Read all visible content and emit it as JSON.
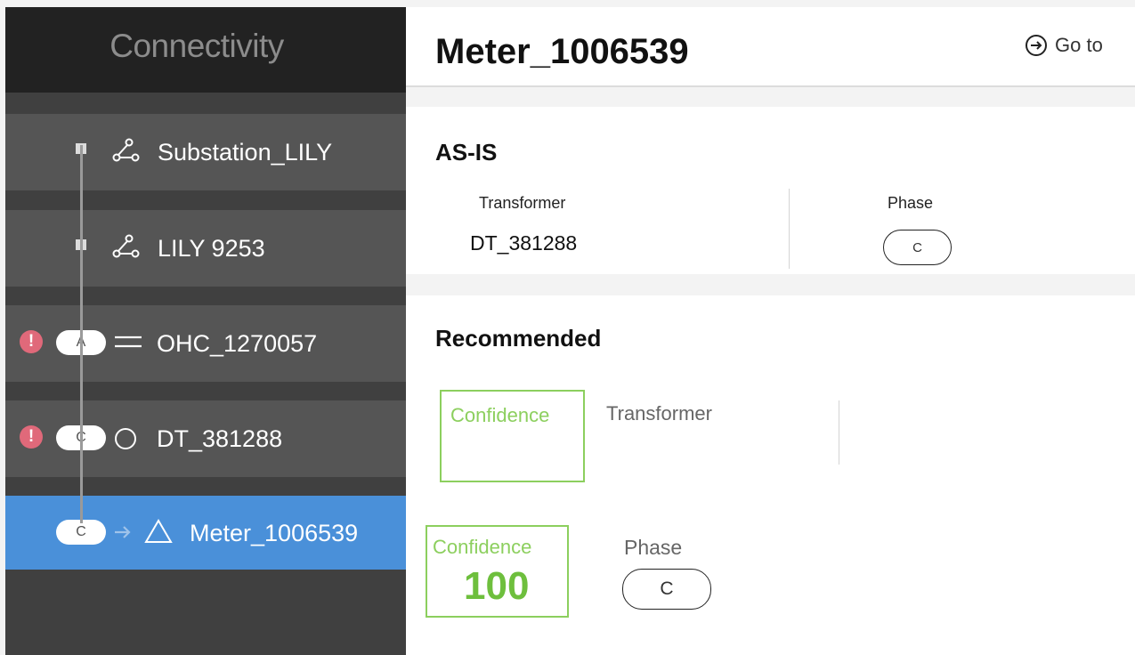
{
  "sidebar": {
    "title": "Connectivity",
    "items": [
      {
        "label": "Substation_LILY",
        "icon": "feeder-icon"
      },
      {
        "label": "LILY 9253",
        "icon": "feeder-icon"
      },
      {
        "label": "OHC_1270057",
        "icon": "conductor-lines-icon",
        "alert": "!",
        "phase": "A"
      },
      {
        "label": "DT_381288",
        "icon": "circle-icon",
        "alert": "!",
        "phase": "C"
      },
      {
        "label": "Meter_1006539",
        "icon": "triangle-icon",
        "phase": "C",
        "selected": true
      }
    ]
  },
  "main": {
    "title": "Meter_1006539",
    "goto_label": "Go to",
    "as_is": {
      "title": "AS-IS",
      "transformer_label": "Transformer",
      "transformer_value": "DT_381288",
      "phase_label": "Phase",
      "phase_value": "C"
    },
    "recommended": {
      "title": "Recommended",
      "transformer_confidence_label": "Confidence",
      "transformer_label": "Transformer",
      "phase_confidence_label": "Confidence",
      "phase_confidence_value": "100",
      "phase_label": "Phase",
      "phase_value": "C"
    }
  },
  "colors": {
    "sidebar_header": "#222222",
    "sidebar_bg": "#404040",
    "row_bg": "#555555",
    "selected_row": "#4a90d9",
    "alert": "#e0697a",
    "confidence_green": "#8ccf5e"
  }
}
